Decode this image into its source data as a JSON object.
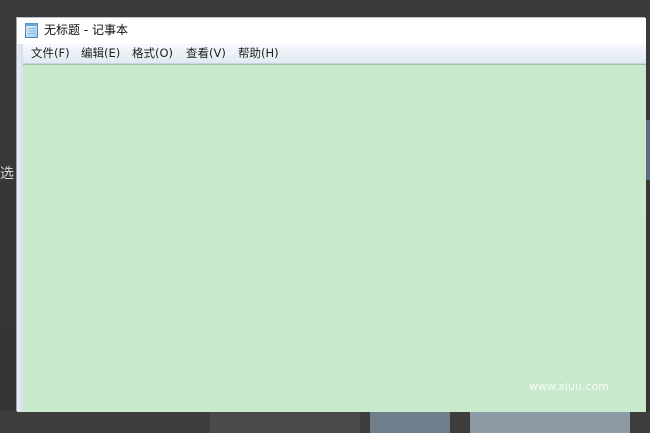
{
  "window": {
    "title": "无标题 - 记事本"
  },
  "menu": {
    "items": [
      {
        "label": "文件(F)"
      },
      {
        "label": "编辑(E)"
      },
      {
        "label": "格式(O)"
      },
      {
        "label": "查看(V)"
      },
      {
        "label": "帮助(H)"
      }
    ]
  },
  "editor": {
    "content": "",
    "background_color": "#c8e9cb"
  },
  "background": {
    "partial_text": "选"
  },
  "watermark": {
    "text": "www.xiuu.com"
  }
}
